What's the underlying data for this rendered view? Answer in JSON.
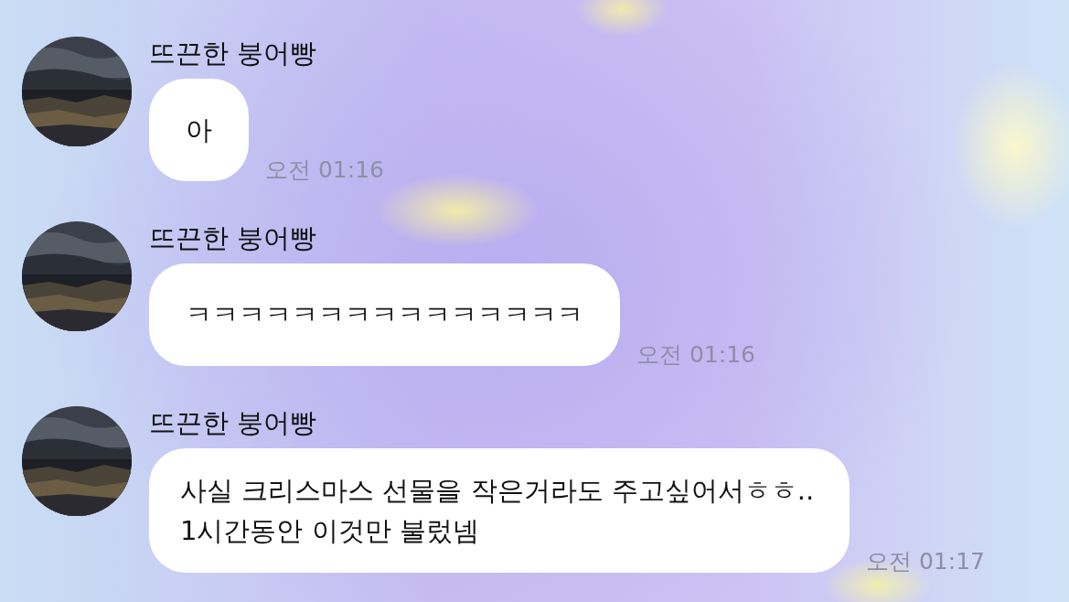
{
  "messages": [
    {
      "sender": "뜨끈한 붕어빵",
      "text": "아",
      "time": "오전 01:16"
    },
    {
      "sender": "뜨끈한 붕어빵",
      "text": "ㅋㅋㅋㅋㅋㅋㅋㅋㅋㅋㅋㅋㅋㅋㅋ",
      "time": "오전 01:16"
    },
    {
      "sender": "뜨끈한 붕어빵",
      "text": "사실 크리스마스 선물을 작은거라도 주고싶어서ㅎㅎ.. 1시간동안 이것만 불렀넴",
      "time": "오전 01:17"
    }
  ]
}
